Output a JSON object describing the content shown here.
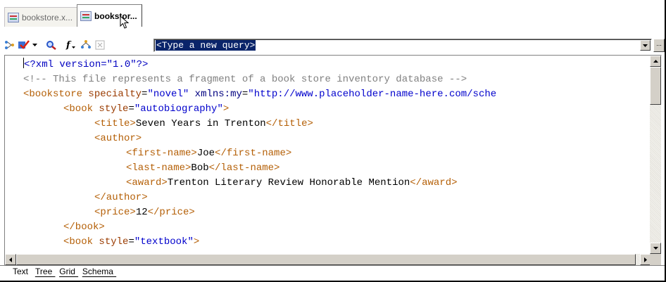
{
  "doc_tabs": [
    {
      "label": "bookstore.x...",
      "active": false,
      "icon": "xml-file-icon"
    },
    {
      "label": "bookstor...",
      "active": true,
      "icon": "xml-file-icon"
    }
  ],
  "toolbar": {
    "icons": [
      "schema-tree-icon",
      "validate-check-icon",
      "dropdown-arrow-icon",
      "find-icon",
      "function-icon",
      "xpath-icon",
      "disabled-tool-icon"
    ],
    "query_placeholder": "<Type a new query>",
    "more_label": "..."
  },
  "code_lines": [
    {
      "indent": 0,
      "parts": [
        [
          "c-pi",
          "<?xml version=\"1.0\"?>"
        ]
      ],
      "caret": true
    },
    {
      "indent": 0,
      "parts": [
        [
          "c-comment",
          "<!-- This file represents a fragment of a book store inventory database -->"
        ]
      ]
    },
    {
      "indent": 0,
      "parts": [
        [
          "c-tag",
          "<bookstore "
        ],
        [
          "c-attr",
          "specialty"
        ],
        [
          "c-text",
          "="
        ],
        [
          "c-val",
          "\"novel\""
        ],
        [
          "c-text",
          " "
        ],
        [
          "c-ns",
          "xmlns:my"
        ],
        [
          "c-text",
          "="
        ],
        [
          "c-val",
          "\"http://www.placeholder-name-here.com/sche"
        ]
      ]
    },
    {
      "indent": 1,
      "parts": [
        [
          "c-tag",
          "<book "
        ],
        [
          "c-attr",
          "style"
        ],
        [
          "c-text",
          "="
        ],
        [
          "c-val",
          "\"autobiography\""
        ],
        [
          "c-tag",
          ">"
        ]
      ]
    },
    {
      "indent": 2,
      "parts": [
        [
          "c-tag",
          "<title>"
        ],
        [
          "c-text",
          "Seven Years in Trenton"
        ],
        [
          "c-tag",
          "</title>"
        ]
      ]
    },
    {
      "indent": 2,
      "parts": [
        [
          "c-tag",
          "<author>"
        ]
      ]
    },
    {
      "indent": 3,
      "parts": [
        [
          "c-tag",
          "<first-name>"
        ],
        [
          "c-text",
          "Joe"
        ],
        [
          "c-tag",
          "</first-name>"
        ]
      ]
    },
    {
      "indent": 3,
      "parts": [
        [
          "c-tag",
          "<last-name>"
        ],
        [
          "c-text",
          "Bob"
        ],
        [
          "c-tag",
          "</last-name>"
        ]
      ]
    },
    {
      "indent": 3,
      "parts": [
        [
          "c-tag",
          "<award>"
        ],
        [
          "c-text",
          "Trenton Literary Review Honorable Mention"
        ],
        [
          "c-tag",
          "</award>"
        ]
      ]
    },
    {
      "indent": 2,
      "parts": [
        [
          "c-tag",
          "</author>"
        ]
      ]
    },
    {
      "indent": 2,
      "parts": [
        [
          "c-tag",
          "<price>"
        ],
        [
          "c-text",
          "12"
        ],
        [
          "c-tag",
          "</price>"
        ]
      ]
    },
    {
      "indent": 1,
      "parts": [
        [
          "c-tag",
          "</book>"
        ]
      ]
    },
    {
      "indent": 1,
      "parts": [
        [
          "c-tag",
          "<book "
        ],
        [
          "c-attr",
          "style"
        ],
        [
          "c-text",
          "="
        ],
        [
          "c-val",
          "\"textbook\""
        ],
        [
          "c-tag",
          ">"
        ]
      ]
    }
  ],
  "view_tabs": [
    {
      "label": "Text",
      "active": true
    },
    {
      "label": "Tree",
      "active": false
    },
    {
      "label": "Grid",
      "active": false
    },
    {
      "label": "Schema",
      "active": false
    }
  ]
}
